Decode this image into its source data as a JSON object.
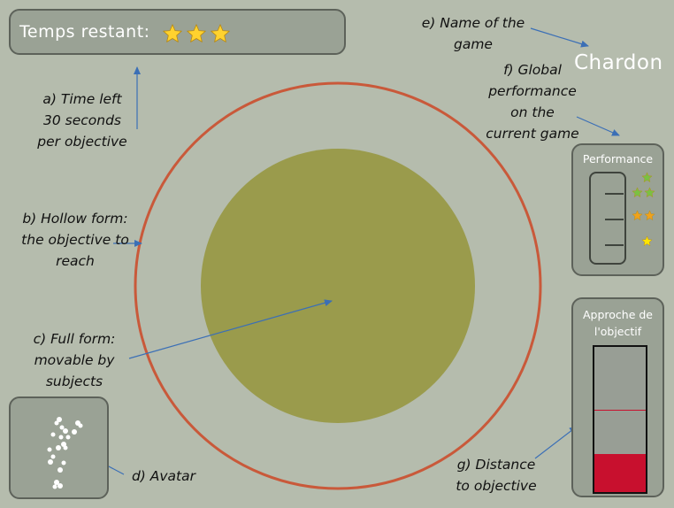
{
  "game": {
    "name": "Chardon"
  },
  "timer": {
    "label": "Temps restant:",
    "stars_remaining": 3,
    "star_color": "#ffd22e"
  },
  "performance": {
    "title": "Performance",
    "levels": [
      {
        "stars": 2,
        "color": "#7ac143"
      },
      {
        "stars": 2,
        "color": "#f0a21b"
      },
      {
        "stars": 1,
        "color": "#ffe600"
      }
    ]
  },
  "approach": {
    "title_line1": "Approche de",
    "title_line2": "l'objectif",
    "fill_fraction": 0.26,
    "target_fraction": 0.56,
    "fill_color": "#c8102e"
  },
  "objective": {
    "hollow_color": "#c9593a",
    "full_color": "#9a9b4c"
  },
  "annotations": {
    "a": [
      "a) Time left",
      "30 seconds",
      "per objective"
    ],
    "b": [
      "b) Hollow form:",
      "the objective to",
      "reach"
    ],
    "c": [
      "c) Full form:",
      "movable by",
      "subjects"
    ],
    "d": [
      "d) Avatar"
    ],
    "e": [
      "e) Name of the",
      "game"
    ],
    "f": [
      "f) Global",
      "performance",
      "on the",
      "current game"
    ],
    "g": [
      "g) Distance",
      "to objective"
    ]
  },
  "colors": {
    "background": "#b5bcad",
    "panel": "#9aa295",
    "arrow": "#3b6fb6"
  }
}
